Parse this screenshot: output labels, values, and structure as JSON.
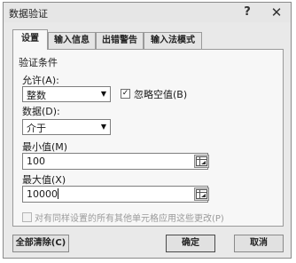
{
  "window": {
    "title": "数据验证",
    "help_label": "?",
    "close_label": "✕"
  },
  "tabs": [
    {
      "label": "设置",
      "active": true
    },
    {
      "label": "输入信息",
      "active": false
    },
    {
      "label": "出错警告",
      "active": false
    },
    {
      "label": "输入法模式",
      "active": false
    }
  ],
  "settings": {
    "group_title": "验证条件",
    "allow_label": "允许(A):",
    "allow_value": "整数",
    "ignore_blank_label": "忽略空值(B)",
    "ignore_blank_checked": true,
    "data_label": "数据(D):",
    "data_value": "介于",
    "min_label": "最小值(M)",
    "min_value": "100",
    "max_label": "最大值(X)",
    "max_value": "10000",
    "apply_all_label": "对有同样设置的所有其他单元格应用这些更改(P)",
    "apply_all_checked": false
  },
  "buttons": {
    "clear_all": "全部清除(C)",
    "ok": "确定",
    "cancel": "取消"
  }
}
